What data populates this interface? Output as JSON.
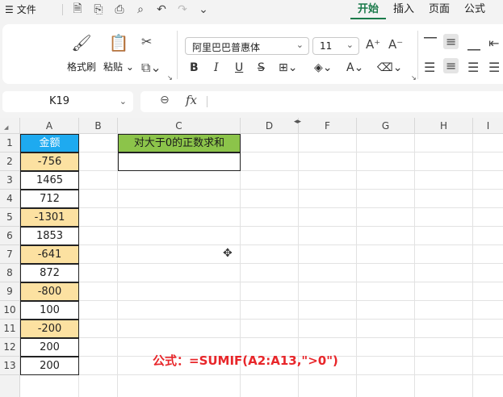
{
  "titlebar": {
    "menu_label": "文件",
    "tabs": [
      {
        "label": "开始",
        "active": true
      },
      {
        "label": "插入",
        "active": false
      },
      {
        "label": "页面",
        "active": false
      },
      {
        "label": "公式",
        "active": false
      }
    ]
  },
  "ribbon": {
    "format_painter_label": "格式刷",
    "paste_label": "粘贴",
    "font_name": "阿里巴巴普惠体",
    "font_size": "11",
    "bold": "B",
    "italic": "I",
    "underline": "U"
  },
  "formula_bar": {
    "name_box": "K19",
    "fx_label": "fx",
    "formula": ""
  },
  "columns": [
    "A",
    "B",
    "C",
    "D",
    "F",
    "G",
    "H",
    "I"
  ],
  "rows": [
    "1",
    "2",
    "3",
    "4",
    "5",
    "6",
    "7",
    "8",
    "9",
    "10",
    "11",
    "12",
    "13"
  ],
  "column_a": {
    "header": "金额",
    "values": [
      "-756",
      "1465",
      "712",
      "-1301",
      "1853",
      "-641",
      "872",
      "-800",
      "100",
      "-200",
      "200",
      "200"
    ]
  },
  "column_c": {
    "header": "对大于0的正数求和",
    "value": ""
  },
  "note": "公式：=SUMIF(A2:A13,\">0\")",
  "colors": {
    "header_blue": "#1eaaf0",
    "header_green": "#8cc44a",
    "negative_fill": "#fce1a1",
    "note_red": "#e8262a",
    "active_tab": "#1a7a4a"
  }
}
